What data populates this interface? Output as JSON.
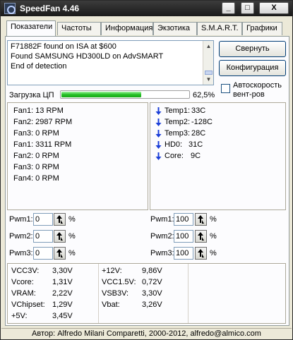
{
  "window": {
    "title": "SpeedFan 4.46",
    "min_label": "_",
    "max_label": "□",
    "close_label": "X"
  },
  "tabs": [
    {
      "label": "Показатели",
      "active": true
    },
    {
      "label": "Частоты"
    },
    {
      "label": "Информация"
    },
    {
      "label": "Экзотика"
    },
    {
      "label": "S.M.A.R.T."
    },
    {
      "label": "Графики"
    }
  ],
  "log": {
    "lines": [
      "F71882F found on ISA at $600",
      "Found SAMSUNG HD300LD on AdvSMART",
      "End of detection"
    ]
  },
  "buttons": {
    "minimize": "Свернуть",
    "configure": "Конфигурация"
  },
  "autofan": {
    "label": "Автоскорость вент-ров",
    "checked": false
  },
  "cpu": {
    "label": "Загрузка ЦП",
    "percent_text": "62,5%",
    "percent": 62.5
  },
  "fans": [
    "Fan1: 13 RPM",
    "Fan2: 2987 RPM",
    "Fan3: 0 RPM",
    "Fan1: 3311 RPM",
    "Fan2: 0 RPM",
    "Fan3: 0 RPM",
    "Fan4: 0 RPM"
  ],
  "temps": [
    {
      "name": "Temp1:",
      "value": "33C",
      "trend": "down"
    },
    {
      "name": "Temp2:",
      "value": "-128C",
      "trend": "down"
    },
    {
      "name": "Temp3:",
      "value": "28C",
      "trend": "down"
    },
    {
      "name": "HD0:",
      "value": "31C",
      "trend": "down"
    },
    {
      "name": "Core:",
      "value": "9C",
      "trend": "down"
    }
  ],
  "pwm_left": [
    {
      "label": "Pwm1:",
      "value": "0",
      "unit": "%"
    },
    {
      "label": "Pwm2:",
      "value": "0",
      "unit": "%"
    },
    {
      "label": "Pwm3:",
      "value": "0",
      "unit": "%"
    }
  ],
  "pwm_right": [
    {
      "label": "Pwm1:",
      "value": "100",
      "unit": "%"
    },
    {
      "label": "Pwm2:",
      "value": "100",
      "unit": "%"
    },
    {
      "label": "Pwm3:",
      "value": "100",
      "unit": "%"
    }
  ],
  "volts_left": [
    {
      "name": "VCC3V:",
      "value": "3,30V"
    },
    {
      "name": "Vcore:",
      "value": "1,31V"
    },
    {
      "name": "VRAM:",
      "value": "2,22V"
    },
    {
      "name": "VChipset:",
      "value": "1,29V"
    },
    {
      "name": "+5V:",
      "value": "3,45V"
    }
  ],
  "volts_right": [
    {
      "name": "+12V:",
      "value": "9,86V"
    },
    {
      "name": "VCC1.5V:",
      "value": "0,72V"
    },
    {
      "name": "VSB3V:",
      "value": "3,30V"
    },
    {
      "name": "Vbat:",
      "value": "3,26V"
    }
  ],
  "status": {
    "text": "Автор: Alfredo Milani Comparetti, 2000-2012, alfredo@almico.com"
  },
  "colors": {
    "trend_arrow": "#1c3fd8",
    "cpu_bar": "#27c127",
    "accent_border": "#003c74"
  }
}
